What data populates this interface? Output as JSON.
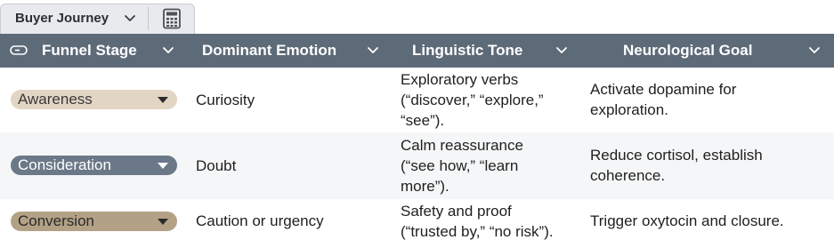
{
  "view_tab": {
    "label": "Buyer Journey",
    "dropdown_icon": "chevron-down-icon",
    "action_icon": "calculator-icon"
  },
  "columns": [
    {
      "label": "Funnel Stage",
      "icon": "pill-icon"
    },
    {
      "label": "Dominant Emotion"
    },
    {
      "label": "Linguistic Tone"
    },
    {
      "label": "Neurological Goal"
    }
  ],
  "rows": [
    {
      "stage": "Awareness",
      "stage_color": "#e3d5c4",
      "stage_text_color": "#3a3a3a",
      "emotion": "Curiosity",
      "tone": [
        "Exploratory verbs",
        "(“discover,” “explore,”",
        "“see”)."
      ],
      "goal": [
        "Activate dopamine for",
        "exploration."
      ]
    },
    {
      "stage": "Consideration",
      "stage_color": "#6a7888",
      "stage_text_color": "#ffffff",
      "emotion": "Doubt",
      "tone": [
        "Calm reassurance",
        "(“see how,” “learn",
        "more”)."
      ],
      "goal": [
        "Reduce cortisol, establish",
        "coherence."
      ]
    },
    {
      "stage": "Conversion",
      "stage_color": "#b3a186",
      "stage_text_color": "#2a2a2a",
      "emotion": "Caution or urgency",
      "tone": [
        "Safety and proof",
        "(“trusted by,” “no risk”)."
      ],
      "goal": [
        "Trigger oxytocin and closure."
      ]
    }
  ]
}
